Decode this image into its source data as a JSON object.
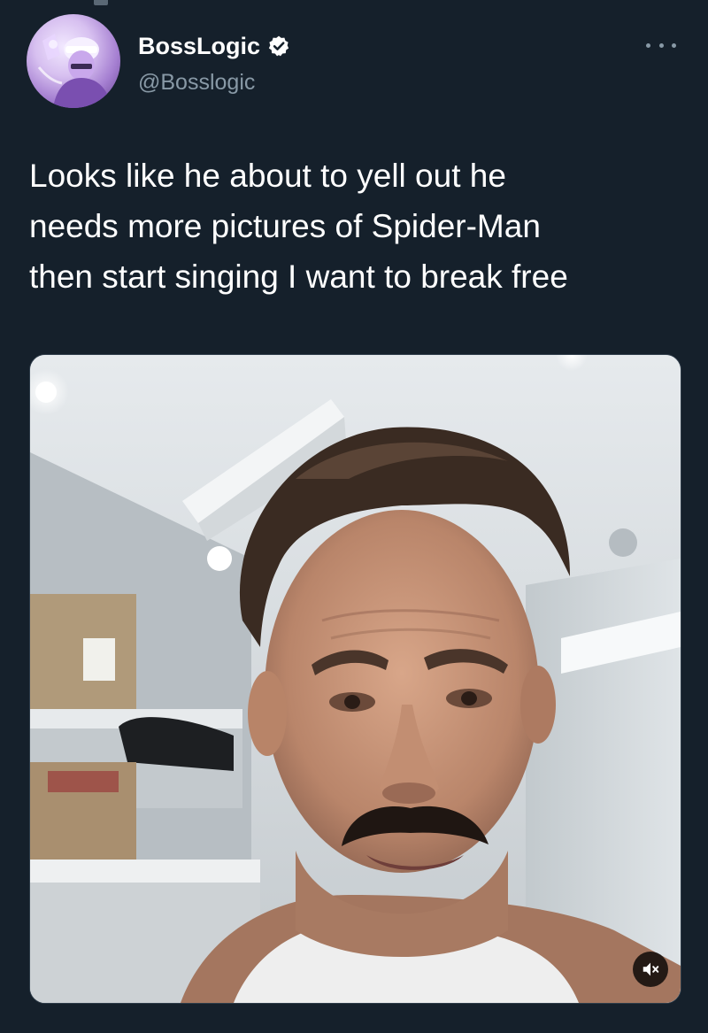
{
  "tweet": {
    "author": {
      "display_name": "BossLogic",
      "handle": "@Bosslogic",
      "verified": true
    },
    "text": "Looks like he about to yell out he\nneeds more pictures of Spider-Man\nthen start singing I want to break free",
    "media": {
      "type": "video",
      "muted": true
    }
  },
  "icons": {
    "verified": "verified-badge-icon",
    "more": "more-options-icon",
    "mute": "speaker-muted-icon"
  },
  "colors": {
    "background": "#15202b",
    "primary_text": "#ffffff",
    "secondary_text": "#8899a6"
  }
}
